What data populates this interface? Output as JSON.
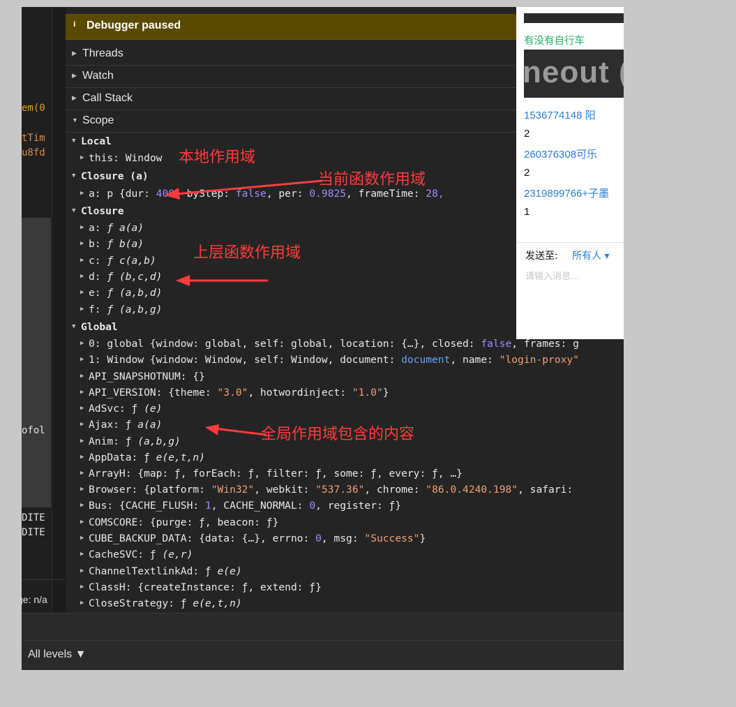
{
  "left_code": {
    "lines": [
      {
        "text": "em(0",
        "color": "#e0a030"
      },
      {
        "text": "tTim",
        "color": "#e08a40"
      },
      {
        "text": "u8fd",
        "color": "#e08a40"
      }
    ],
    "lower_lines": [
      "ofol",
      "DITE",
      "DITE"
    ],
    "page_label": "ge: n/a"
  },
  "debugger": {
    "info_icon": "i",
    "paused_label": "Debugger paused"
  },
  "sections": {
    "threads": "Threads",
    "watch": "Watch",
    "call_stack": "Call Stack",
    "scope": "Scope"
  },
  "scope": {
    "local": {
      "label": "Local",
      "this_row": "this: Window"
    },
    "closure_a": {
      "label": "Closure (a)",
      "row_key": "a: p {dur: ",
      "dur": "400",
      "by_step_key": ", byStep: ",
      "by_step": "false",
      "per_key": ", per: ",
      "per": "0.9825",
      "frame_key": ", frameTime: ",
      "frame": "28,"
    },
    "closure": {
      "label": "Closure",
      "items": [
        {
          "key": "a: ",
          "f": "ƒ ",
          "sig": "a(a)"
        },
        {
          "key": "b: ",
          "f": "ƒ ",
          "sig": "b(a)"
        },
        {
          "key": "c: ",
          "f": "ƒ ",
          "sig": "c(a,b)"
        },
        {
          "key": "d: ",
          "f": "ƒ ",
          "sig": "(b,c,d)"
        },
        {
          "key": "e: ",
          "f": "ƒ ",
          "sig": "(a,b,d)"
        },
        {
          "key": "f: ",
          "f": "ƒ ",
          "sig": "(a,b,g)"
        }
      ]
    },
    "global": {
      "label": "Global",
      "row0": {
        "a": "0: global {window: global, self: global, location: {…}, closed: ",
        "b": "false",
        "c": ", frames: g"
      },
      "row1": {
        "a": "1: Window {window: Window, self: Window, document: ",
        "b": "document",
        "c": ", name: ",
        "d": "\"login-proxy\""
      },
      "row2": "API_SNAPSHOTNUM: {}",
      "row3": {
        "a": "API_VERSION: {theme: ",
        "b": "\"3.0\"",
        "c": ", hotwordinject: ",
        "d": "\"1.0\"",
        "e": "}"
      },
      "row4": {
        "a": "AdSvc: ƒ ",
        "b": "(e)"
      },
      "row5": {
        "a": "Ajax: ƒ ",
        "b": "a(a)"
      },
      "row6": {
        "a": "Anim: ƒ ",
        "b": "(a,b,g)"
      },
      "row7": {
        "a": "AppData: ƒ ",
        "b": "e(e,t,n)"
      },
      "row8": "ArrayH: {map: ƒ, forEach: ƒ, filter: ƒ, some: ƒ, every: ƒ, …}",
      "row9": {
        "a": "Browser: {platform: ",
        "b": "\"Win32\"",
        "c": ", webkit: ",
        "d": "\"537.36\"",
        "e": ", chrome: ",
        "f": "\"86.0.4240.198\"",
        "g": ", safari:"
      },
      "row10": {
        "a": "Bus: {CACHE_FLUSH: ",
        "b": "1",
        "c": ", CACHE_NORMAL: ",
        "d": "0",
        "e": ", register: ƒ}"
      },
      "row11": "COMSCORE: {purge: ƒ, beacon: ƒ}",
      "row12": {
        "a": "CUBE_BACKUP_DATA: {data: {…}, errno: ",
        "b": "0",
        "c": ", msg: ",
        "d": "\"Success\"",
        "e": "}"
      },
      "row13": {
        "a": "CacheSVC: ƒ ",
        "b": "(e,r)"
      },
      "row14": {
        "a": "ChannelTextlinkAd: ƒ ",
        "b": "e(e)"
      },
      "row15": "ClassH: {createInstance: ƒ, extend: ƒ}",
      "row16": {
        "a": "CloseStrategy: ƒ ",
        "b": "e(e,t,n)"
      }
    }
  },
  "annotations": {
    "local": "本地作用域",
    "closure_a": "当前函数作用域",
    "closure": "上层函数作用域",
    "global": "全局作用域包含的内容"
  },
  "chat": {
    "green_text": "有没有自行车",
    "banner_text": "neout (as",
    "messages": [
      {
        "text": "1536774148 阳",
        "style": "blue"
      },
      {
        "text": "2",
        "style": "blk"
      },
      {
        "text": "260376308可乐",
        "style": "blue"
      },
      {
        "text": "2",
        "style": "blk"
      },
      {
        "text": "2319899766+子墨",
        "style": "blue"
      },
      {
        "text": "1",
        "style": "blk"
      }
    ],
    "send_to_label": "发送至:",
    "recipient": "所有人 ▾",
    "input_placeholder": "请输入消息..."
  },
  "console": {
    "levels": "All levels ▼"
  },
  "colors": {
    "annotation": "#ff3b3b",
    "pause_bar": "#5a4a00",
    "number": "#9d8cff",
    "string": "#f0a070"
  }
}
